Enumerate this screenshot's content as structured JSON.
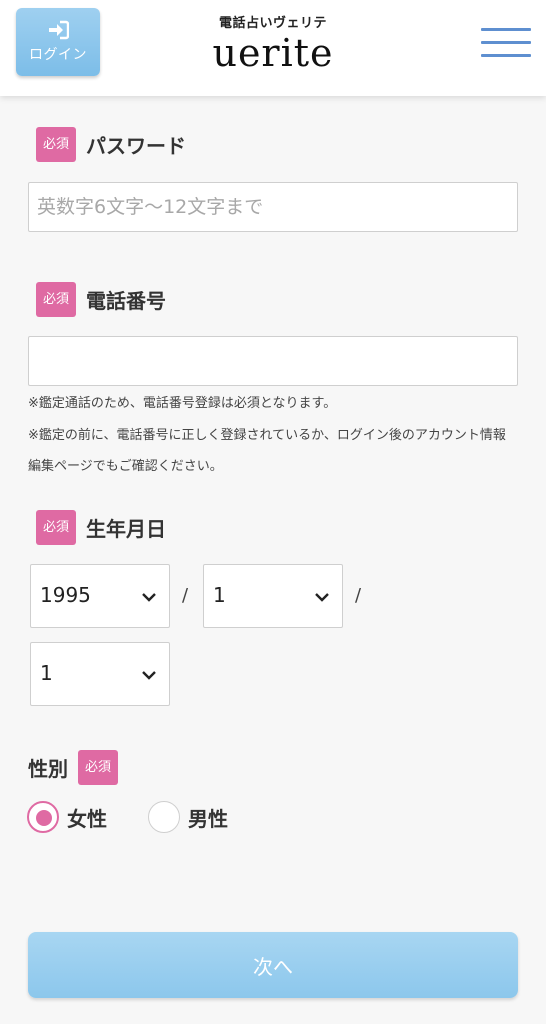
{
  "header": {
    "login_label": "ログイン",
    "logo_tagline": "電話占いヴェリテ",
    "logo_word": "uerite"
  },
  "required_badge": "必須",
  "password": {
    "label": "パスワード",
    "placeholder": "英数字6文字〜12文字まで",
    "value": ""
  },
  "phone": {
    "label": "電話番号",
    "value": "",
    "note_1": "※鑑定通話のため、電話番号登録は必須となります。",
    "note_2": "※鑑定の前に、電話番号に正しく登録されているか、ログイン後のアカウント情報編集ページでもご確認ください。"
  },
  "birthday": {
    "label": "生年月日",
    "year": "1995",
    "month": "1",
    "day": "1",
    "separator": "/"
  },
  "gender": {
    "label": "性別",
    "options": [
      {
        "label": "女性",
        "checked": true
      },
      {
        "label": "男性",
        "checked": false
      }
    ]
  },
  "next_label": "次へ",
  "colors": {
    "accent_pink": "#df6aa3",
    "button_blue": "#8cc7ec",
    "menu_blue": "#5e8fd0"
  }
}
